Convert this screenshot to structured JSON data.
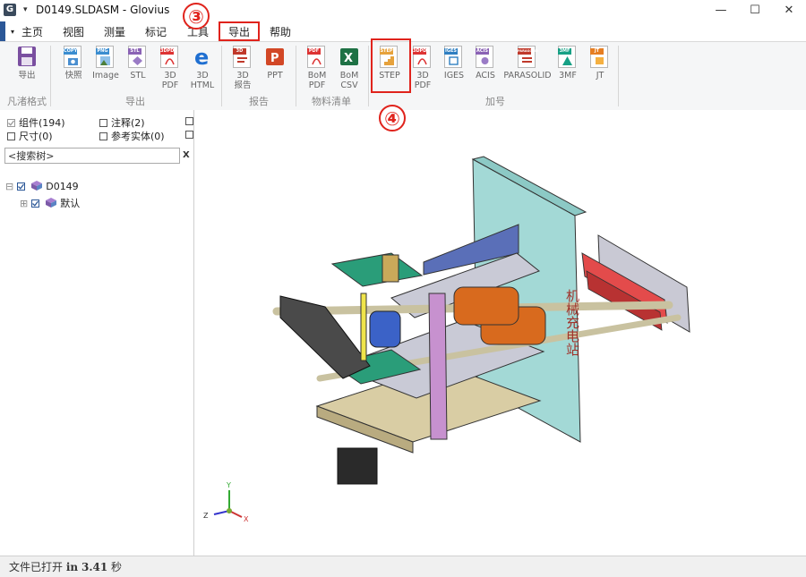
{
  "app": {
    "title": "D0149.SLDASM - Glovius",
    "icon_letter": "G"
  },
  "window_controls": {
    "minimize": "—",
    "maximize": "☐",
    "close": "✕"
  },
  "menu": [
    "主页",
    "视图",
    "测量",
    "标记",
    "工具",
    "导出",
    "帮助"
  ],
  "ribbon": {
    "groups": {
      "fanzhu": {
        "label": "凡渚格式",
        "buttons": [
          "导出"
        ]
      },
      "export": {
        "label": "导出",
        "buttons": [
          "快照",
          "Image",
          "STL",
          "3D PDF",
          "3D HTML"
        ]
      },
      "report": {
        "label": "报告",
        "buttons": [
          "3D 报告",
          "PPT"
        ]
      },
      "bom": {
        "label": "物料清单",
        "buttons": [
          "BoM PDF",
          "BoM CSV"
        ]
      },
      "addon": {
        "label": "加号",
        "buttons": [
          "STEP",
          "3D PDF",
          "IGES",
          "ACIS",
          "PARASOLID",
          "3MF",
          "JT"
        ]
      }
    },
    "icon_tags": {
      "snapshot": "COPY",
      "image": "PNG",
      "stl": "STL",
      "pdf": "3DPDF",
      "bompdf": "PDF",
      "step": "STEP",
      "addpdf": "3DPDF",
      "iges": "IGES",
      "acis": "ACIS",
      "parasolid": "PARASOLID",
      "threemf": "3MF",
      "jt": "JT"
    }
  },
  "filters": [
    {
      "label": "组件(194)",
      "checked": true
    },
    {
      "label": "注释(2)",
      "checked": false
    },
    {
      "label": "尺寸(0)",
      "checked": false
    },
    {
      "label": "参考实体(0)",
      "checked": false
    }
  ],
  "search": {
    "placeholder": "<搜索树>",
    "clear": "X"
  },
  "tree": [
    {
      "label": "D0149",
      "expander": "⊟"
    },
    {
      "label": "默认",
      "expander": "⊞"
    }
  ],
  "viewport": {
    "plate_text": "机械充电站"
  },
  "axis": {
    "y": "Y",
    "z": "Z",
    "x": "X"
  },
  "status": {
    "prefix": "文件已打开",
    "in": "in",
    "time": "3.41",
    "unit": "秒"
  },
  "annotations": {
    "step3": "③",
    "step4": "④"
  }
}
